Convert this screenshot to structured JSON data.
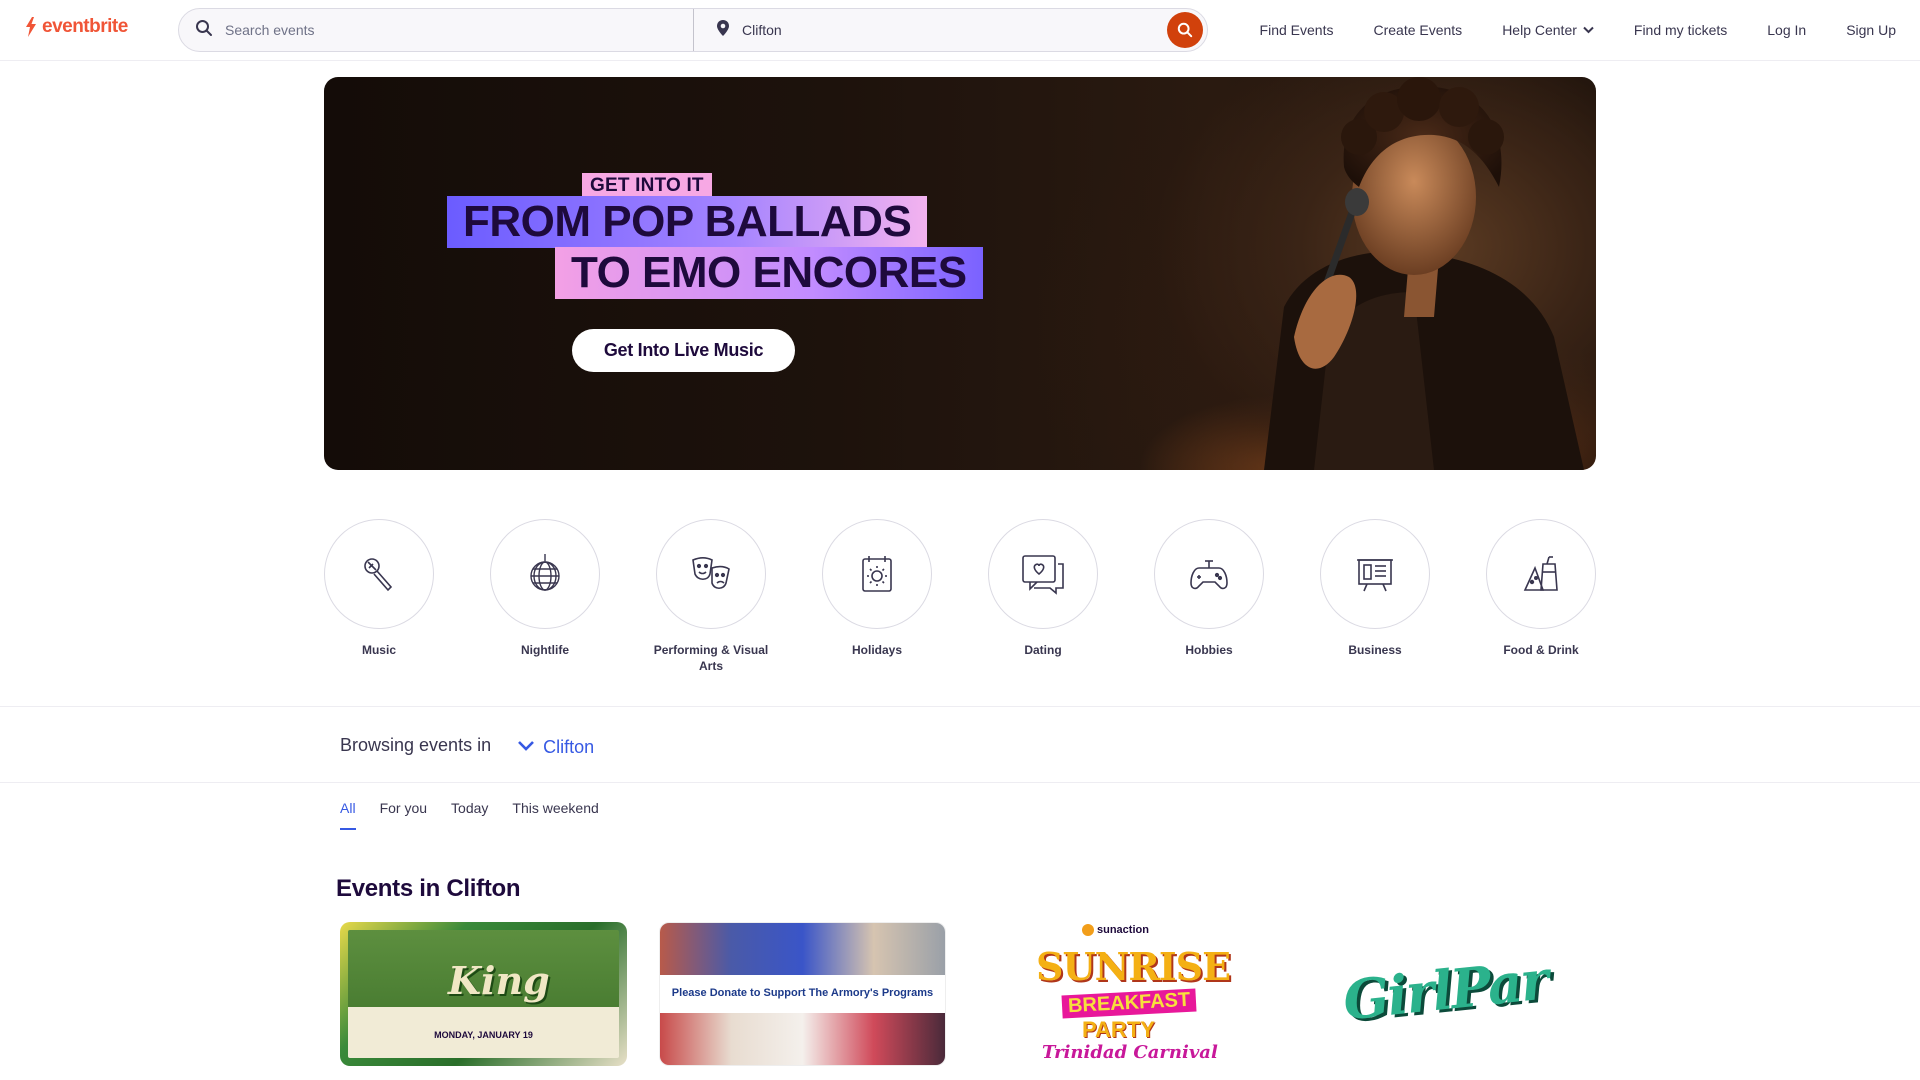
{
  "header": {
    "logo_text": "eventbrite",
    "search": {
      "placeholder": "Search events",
      "location_value": "Clifton"
    },
    "nav": [
      {
        "label": "Find Events"
      },
      {
        "label": "Create Events"
      },
      {
        "label": "Help Center"
      },
      {
        "label": "Find my tickets"
      },
      {
        "label": "Log In"
      },
      {
        "label": "Sign Up"
      }
    ]
  },
  "hero": {
    "eyebrow": "GET INTO IT",
    "line1": "FROM POP BALLADS",
    "line2": "TO EMO ENCORES",
    "cta": "Get Into Live Music"
  },
  "categories": [
    {
      "label": "Music",
      "icon": "microphone-icon"
    },
    {
      "label": "Nightlife",
      "icon": "disco-ball-icon"
    },
    {
      "label": "Performing & Visual Arts",
      "icon": "theater-masks-icon"
    },
    {
      "label": "Holidays",
      "icon": "calendar-sun-icon"
    },
    {
      "label": "Dating",
      "icon": "chat-heart-icon"
    },
    {
      "label": "Hobbies",
      "icon": "gamepad-icon"
    },
    {
      "label": "Business",
      "icon": "presentation-board-icon"
    },
    {
      "label": "Food & Drink",
      "icon": "drinks-icon"
    }
  ],
  "browsing": {
    "label": "Browsing events in",
    "location": "Clifton"
  },
  "tabs": [
    {
      "label": "All",
      "active": true
    },
    {
      "label": "For you"
    },
    {
      "label": "Today"
    },
    {
      "label": "This weekend"
    }
  ],
  "events": {
    "title": "Events in Clifton",
    "cards": [
      {
        "art_text": "King",
        "art_subtext": "MONDAY, JANUARY 19"
      },
      {
        "art_text": "Please Donate to Support The Armory's Programs"
      },
      {
        "art_brand": "sunaction",
        "art_text": "SUNRISE",
        "art_text2": "BREAKFAST",
        "art_text3": "PARTY",
        "art_text4": "Trinidad Carnival"
      },
      {
        "art_text": "GirlPar"
      }
    ]
  },
  "colors": {
    "brand": "#f05537",
    "search_button": "#d1410c",
    "link_blue": "#3659e3",
    "text_dark": "#1e0a3c"
  }
}
